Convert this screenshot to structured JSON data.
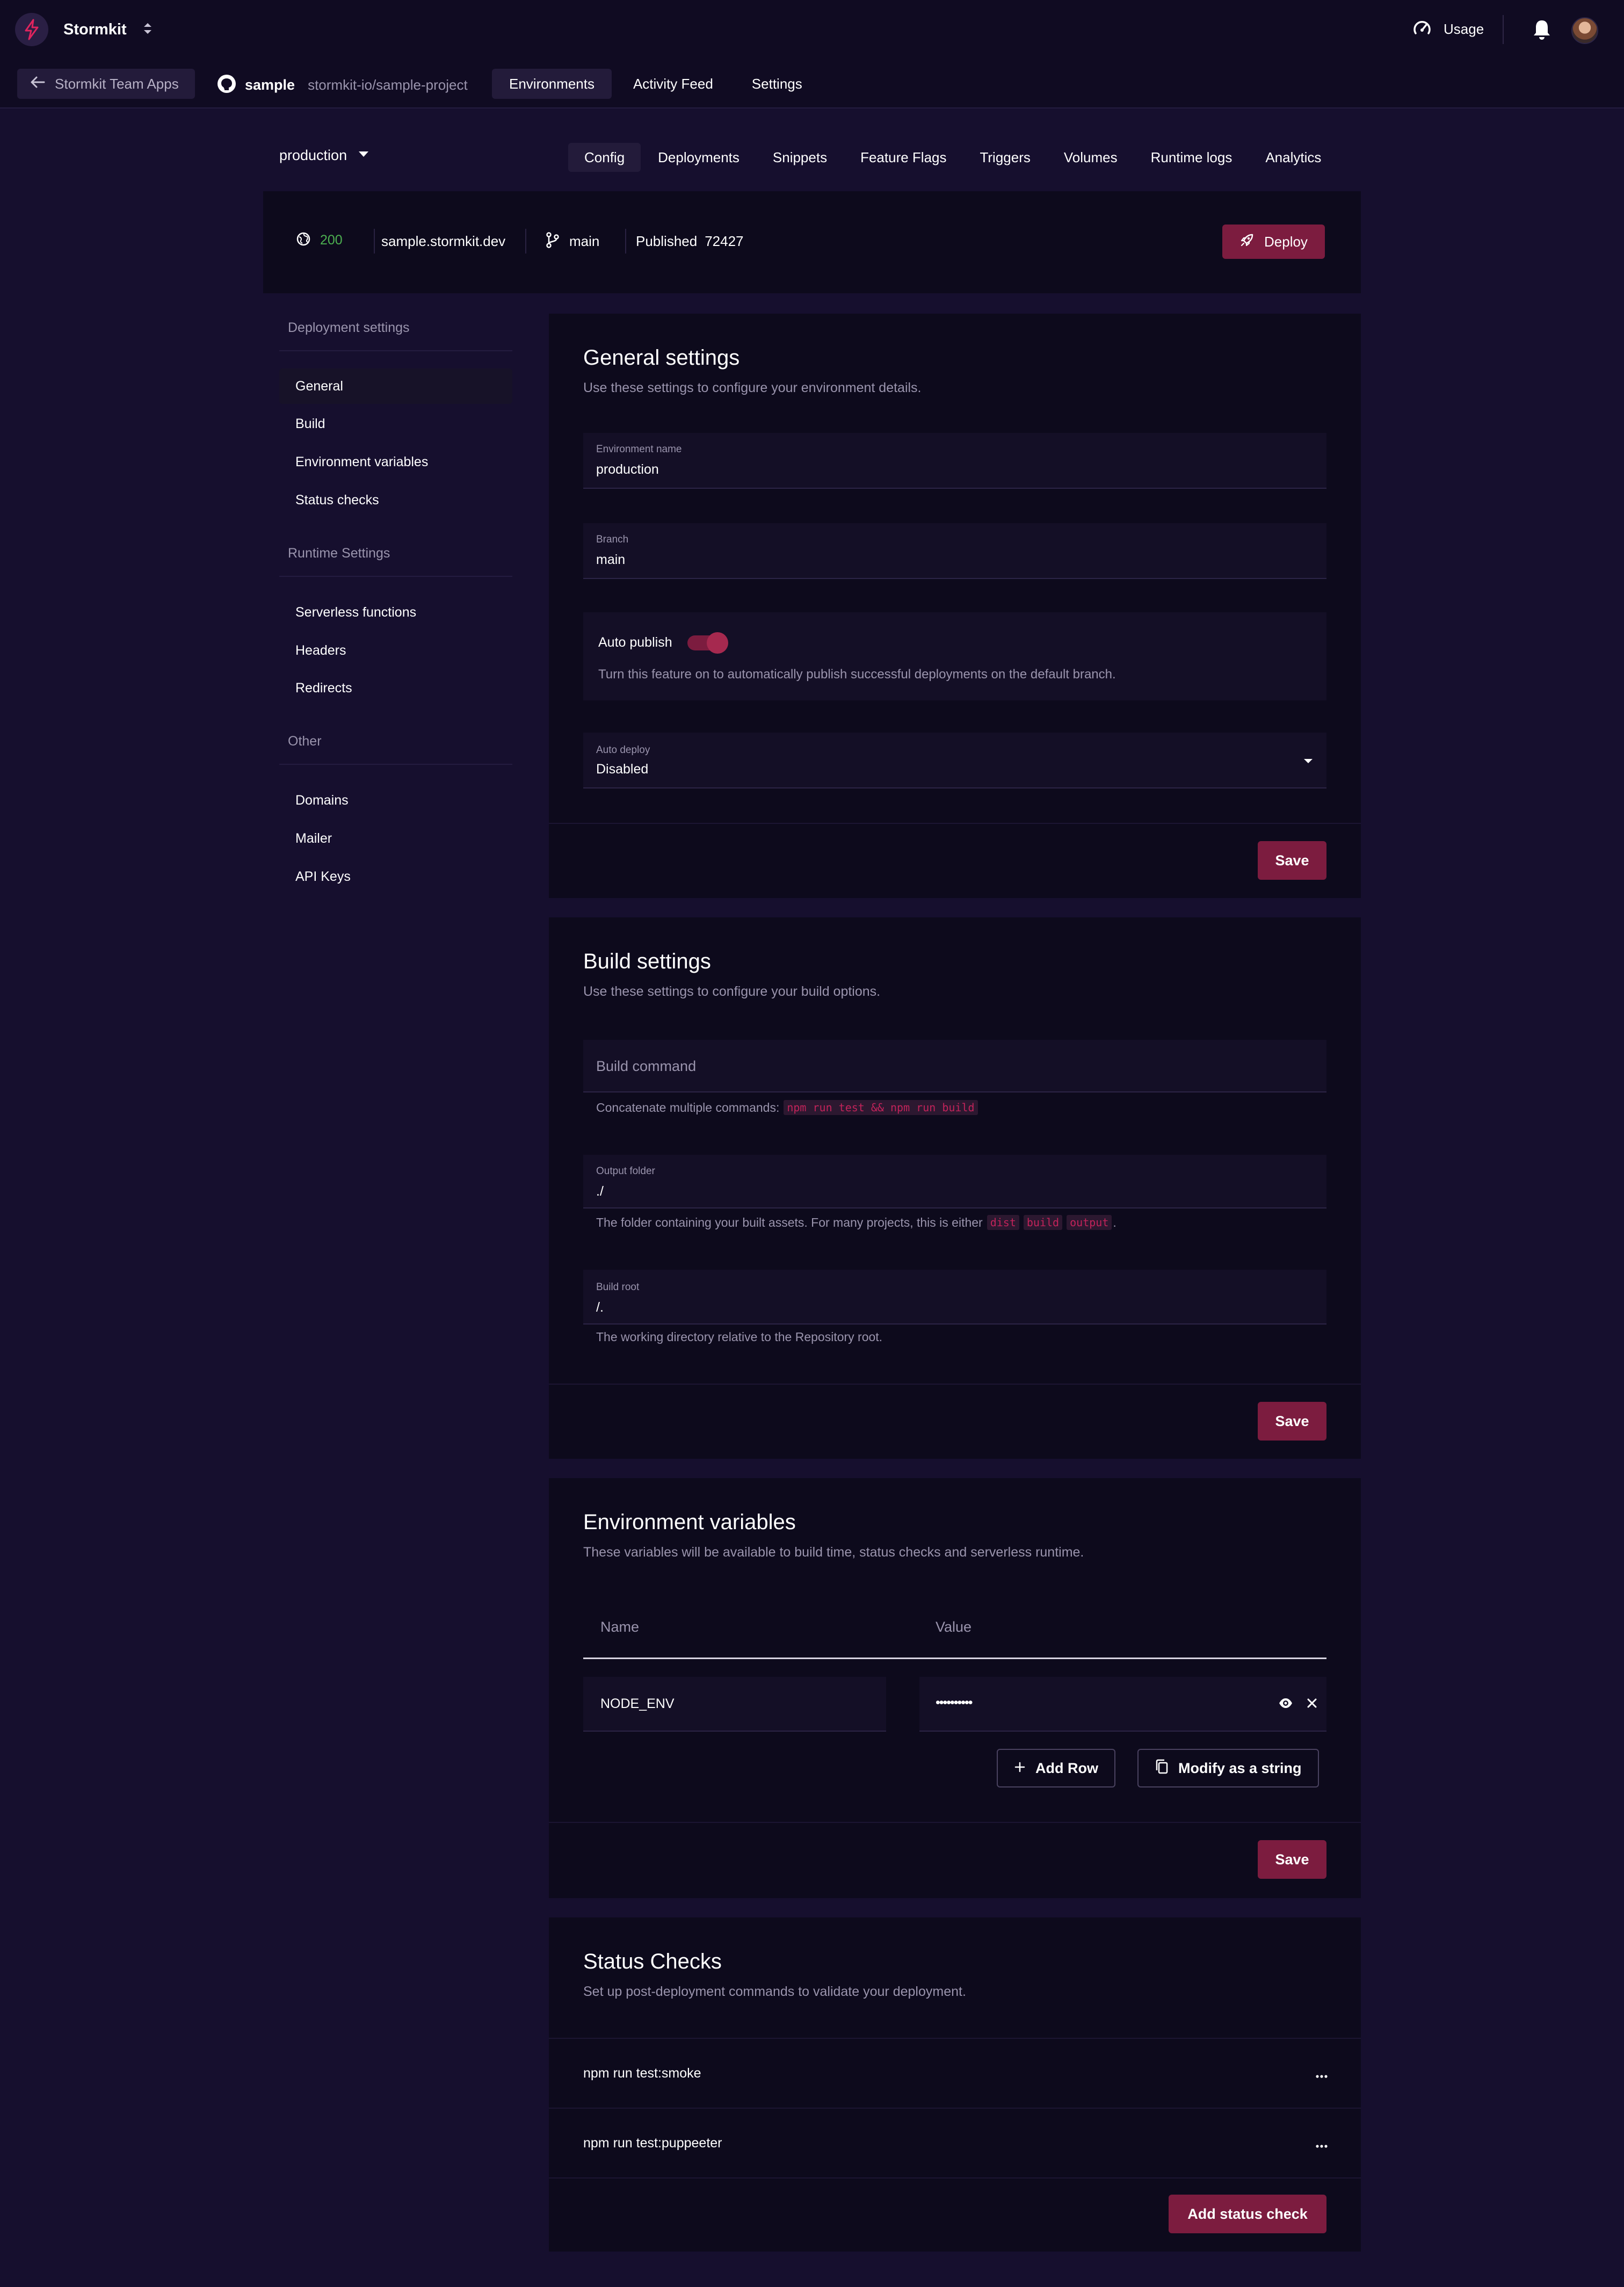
{
  "topbar": {
    "brand": "Stormkit",
    "usage_label": "Usage"
  },
  "subbar": {
    "back_label": "Stormkit Team Apps",
    "app_name": "sample",
    "repo": "stormkit-io/sample-project",
    "nav": [
      "Environments",
      "Activity Feed",
      "Settings"
    ]
  },
  "env": {
    "selected": "production",
    "tabs": [
      "Config",
      "Deployments",
      "Snippets",
      "Feature Flags",
      "Triggers",
      "Volumes",
      "Runtime logs",
      "Analytics"
    ]
  },
  "deploy_bar": {
    "status_code": "200",
    "domain": "sample.stormkit.dev",
    "branch": "main",
    "published_label": "Published",
    "published_id": "72427",
    "deploy_label": "Deploy"
  },
  "sidebar": {
    "groups": [
      {
        "title": "Deployment settings",
        "items": [
          "General",
          "Build",
          "Environment variables",
          "Status checks"
        ]
      },
      {
        "title": "Runtime Settings",
        "items": [
          "Serverless functions",
          "Headers",
          "Redirects"
        ]
      },
      {
        "title": "Other",
        "items": [
          "Domains",
          "Mailer",
          "API Keys"
        ]
      }
    ]
  },
  "general": {
    "title": "General settings",
    "subtitle": "Use these settings to configure your environment details.",
    "env_name_label": "Environment name",
    "env_name_value": "production",
    "branch_label": "Branch",
    "branch_value": "main",
    "auto_publish_label": "Auto publish",
    "auto_publish_on": true,
    "auto_publish_help": "Turn this feature on to automatically publish successful deployments on the default branch.",
    "auto_deploy_label": "Auto deploy",
    "auto_deploy_value": "Disabled",
    "save_label": "Save"
  },
  "build": {
    "title": "Build settings",
    "subtitle": "Use these settings to configure your build options.",
    "build_command_placeholder": "Build command",
    "build_command_help": "Concatenate multiple commands:",
    "build_command_code": "npm run test && npm run build",
    "output_label": "Output folder",
    "output_value": "./",
    "output_help": "The folder containing your built assets. For many projects, this is either",
    "output_codes": [
      "dist",
      "build",
      "output"
    ],
    "output_help_end": ".",
    "root_label": "Build root",
    "root_value": "/.",
    "root_help": "The working directory relative to the Repository root.",
    "save_label": "Save"
  },
  "envvars": {
    "title": "Environment variables",
    "subtitle": "These variables will be available to build time, status checks and serverless runtime.",
    "col_name": "Name",
    "col_value": "Value",
    "row_name": "NODE_ENV",
    "row_value": "••••••••••",
    "add_row_label": "Add Row",
    "modify_label": "Modify as a string",
    "save_label": "Save"
  },
  "status_checks": {
    "title": "Status Checks",
    "subtitle": "Set up post-deployment commands to validate your deployment.",
    "items": [
      "npm run test:smoke",
      "npm run test:puppeeter"
    ],
    "add_label": "Add status check"
  }
}
